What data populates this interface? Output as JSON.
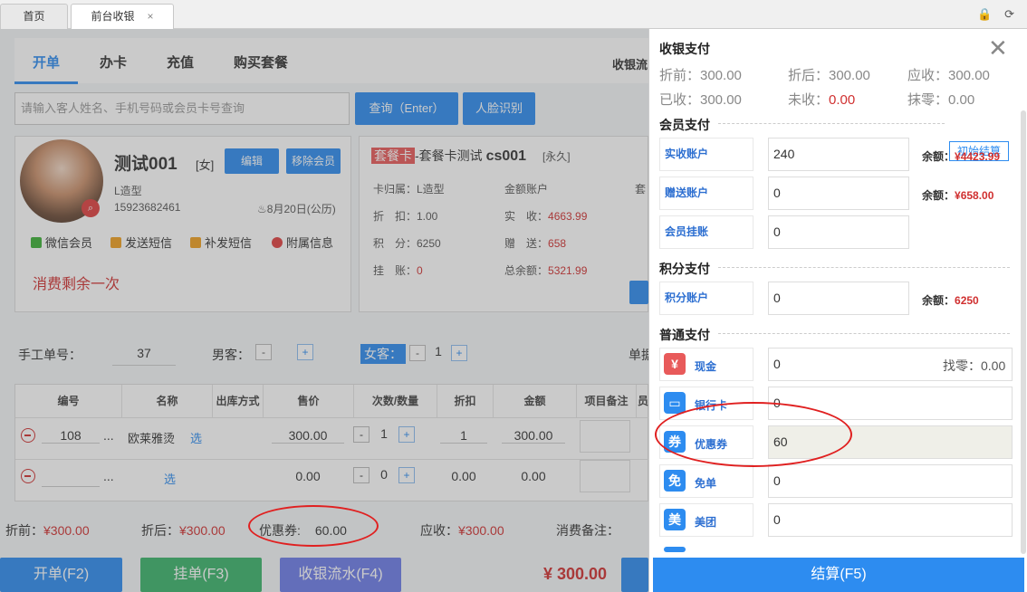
{
  "tabs": {
    "home": "首页",
    "active": "前台收银",
    "close": "×"
  },
  "top_icons": {
    "lock": "🔒",
    "refresh": "⟳"
  },
  "nav": {
    "open": "开单",
    "card": "办卡",
    "recharge": "充值",
    "package": "购买套餐",
    "flow": "收银流"
  },
  "search": {
    "placeholder": "请输入客人姓名、手机号码或会员卡号查询",
    "query_btn": "查询（Enter）",
    "face_btn": "人脸识别"
  },
  "member": {
    "name": "测试001",
    "gender": "[女]",
    "edit": "编辑",
    "remove": "移除会员",
    "style": "L造型",
    "phone": "15923682461",
    "birthday": "8月20日(公历)",
    "links": [
      "微信会员",
      "发送短信",
      "补发短信",
      "附属信息"
    ],
    "remain": "消费剩余一次"
  },
  "pkg": {
    "tag": "套餐卡",
    "title": "-套餐卡测试",
    "code": "cs001",
    "period": "[永久]",
    "belong": "卡归属：L造型",
    "discount": "折　扣：1.00",
    "points": "积　分：6250",
    "hang_label": "挂　账：",
    "hang": "0",
    "acct": "金额账户",
    "real_label": "实　收：",
    "real": "4663.99",
    "gift_label": "赠　送：",
    "gift": "658",
    "total_label": "总余额：",
    "total": "5321.99",
    "more": "套"
  },
  "orderrow": {
    "manual": "手工单号：",
    "manual_no": "37",
    "male": "男客：",
    "female": "女客：",
    "female_count": "1",
    "minus": "-",
    "plus": "+",
    "single": "单据"
  },
  "table": {
    "headers": [
      "编号",
      "名称",
      "出库方式",
      "售价",
      "次数/数量",
      "折扣",
      "金额",
      "项目备注",
      "员"
    ],
    "rows": [
      {
        "code": "108",
        "more": "...",
        "name": "欧莱雅烫",
        "select": "选",
        "price": "300.00",
        "qty": "1",
        "discount": "1",
        "amount": "300.00"
      },
      {
        "code": "",
        "more": "...",
        "name": "",
        "select": "选",
        "price": "0.00",
        "qty": "0",
        "discount": "0.00",
        "amount": "0.00"
      }
    ]
  },
  "summary": {
    "before_label": "折前：",
    "before": "¥300.00",
    "after_label": "折后：",
    "after": "¥300.00",
    "coupon_label": "优惠券:",
    "coupon": "60.00",
    "due_label": "应收：",
    "due": "¥300.00",
    "note_label": "消费备注："
  },
  "bottom": {
    "open": "开单(F2)",
    "hang": "挂单(F3)",
    "flow": "收银流水(F4)",
    "total": "¥ 300.00"
  },
  "pay": {
    "title": "收银支付",
    "close": "✕",
    "before": "折前：300.00",
    "after": "折后：300.00",
    "due": "应收：300.00",
    "received": "已收：300.00",
    "unpaid_label": "未收：",
    "unpaid": "0.00",
    "round": "抹零：0.00",
    "member_sec": "会员支付",
    "init_btn": "初始结算",
    "member_rows": [
      {
        "label": "实收账户",
        "value": "240",
        "bal_label": "余额：",
        "bal": "¥4423.99"
      },
      {
        "label": "赠送账户",
        "value": "0",
        "bal_label": "余额：",
        "bal": "¥658.00"
      },
      {
        "label": "会员挂账",
        "value": "0",
        "bal_label": "",
        "bal": ""
      }
    ],
    "points_sec": "积分支付",
    "points_row": {
      "label": "积分账户",
      "value": "0",
      "bal_label": "余额：",
      "bal": "6250"
    },
    "normal_sec": "普通支付",
    "normal_rows": [
      {
        "icon": "¥",
        "name": "现金",
        "value": "0",
        "extra": "找零：0.00",
        "color": "#e85a5a"
      },
      {
        "icon": "▭",
        "name": "银行卡",
        "value": "0",
        "extra": "",
        "color": "#2d8cf0"
      },
      {
        "icon": "券",
        "name": "优惠券",
        "value": "60",
        "extra": "",
        "color": "#2d8cf0"
      },
      {
        "icon": "免",
        "name": "免单",
        "value": "0",
        "extra": "",
        "color": "#2d8cf0"
      },
      {
        "icon": "美",
        "name": "美团",
        "value": "0",
        "extra": "",
        "color": "#2d8cf0"
      }
    ],
    "settle": "结算(F5)"
  }
}
